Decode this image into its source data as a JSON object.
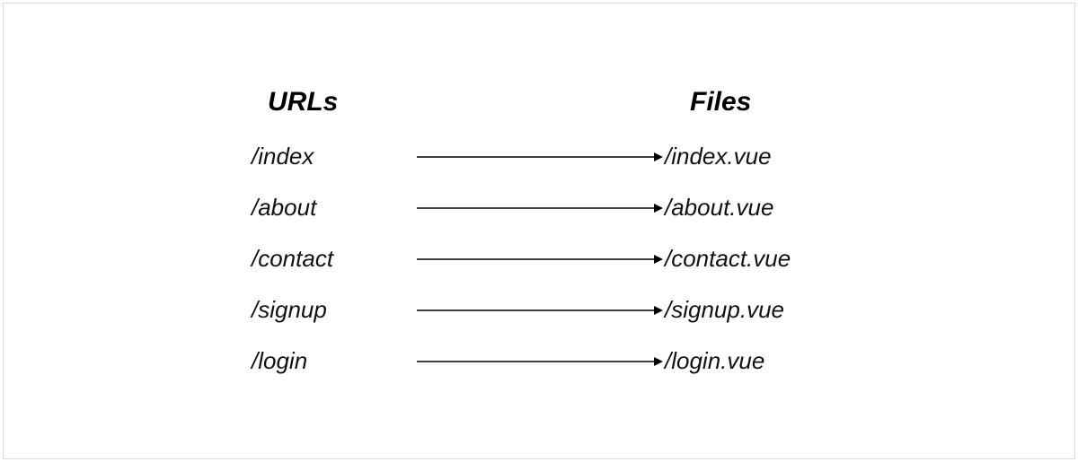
{
  "headers": {
    "left": "URLs",
    "right": "Files"
  },
  "rows": [
    {
      "url": "/index",
      "file": "/index.vue"
    },
    {
      "url": "/about",
      "file": "/about.vue"
    },
    {
      "url": "/contact",
      "file": "/contact.vue"
    },
    {
      "url": "/signup",
      "file": "/signup.vue"
    },
    {
      "url": "/login",
      "file": "/login.vue"
    }
  ]
}
